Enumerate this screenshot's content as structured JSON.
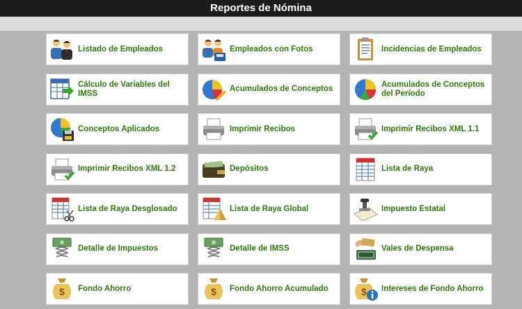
{
  "header": {
    "title": "Reportes de Nómina"
  },
  "reports": [
    {
      "label": "Listado de Empleados",
      "icon": "employees-icon"
    },
    {
      "label": "Empleados con Fotos",
      "icon": "employees-photos-icon"
    },
    {
      "label": "Incidencias de Empleados",
      "icon": "clipboard-icon"
    },
    {
      "label": "Cálculo de Variables del IMSS",
      "icon": "spreadsheet-arrow-icon"
    },
    {
      "label": "Acumulados de Conceptos",
      "icon": "pie-chart-pencil-icon"
    },
    {
      "label": "Acumulados de Conceptos del Período",
      "icon": "pie-chart-icon"
    },
    {
      "label": "Conceptos Aplicados",
      "icon": "pie-chart-disk-icon"
    },
    {
      "label": "Imprimir Recibos",
      "icon": "printer-icon"
    },
    {
      "label": "Imprimir Recibos XML 1.1",
      "icon": "printer-check-icon"
    },
    {
      "label": "Imprimir Recibos XML 1.2",
      "icon": "printer-check-icon"
    },
    {
      "label": "Depósitos",
      "icon": "wallet-icon"
    },
    {
      "label": "Lista de Raya",
      "icon": "table-icon"
    },
    {
      "label": "Lista de Raya Desglosado",
      "icon": "table-scissors-icon"
    },
    {
      "label": "Lista de Raya Global",
      "icon": "table-pyramid-icon"
    },
    {
      "label": "Impuesto Estatal",
      "icon": "document-stamp-icon"
    },
    {
      "label": "Detalle de Impuestos",
      "icon": "money-spring-icon"
    },
    {
      "label": "Detalle de IMSS",
      "icon": "money-spring-icon"
    },
    {
      "label": "Vales de Despensa",
      "icon": "vouchers-icon"
    },
    {
      "label": "Fondo Ahorro",
      "icon": "money-bag-icon"
    },
    {
      "label": "Fondo Ahorro Acumulado",
      "icon": "money-bag-icon"
    },
    {
      "label": "Intereses de Fondo Ahorro",
      "icon": "money-bag-info-icon"
    }
  ]
}
